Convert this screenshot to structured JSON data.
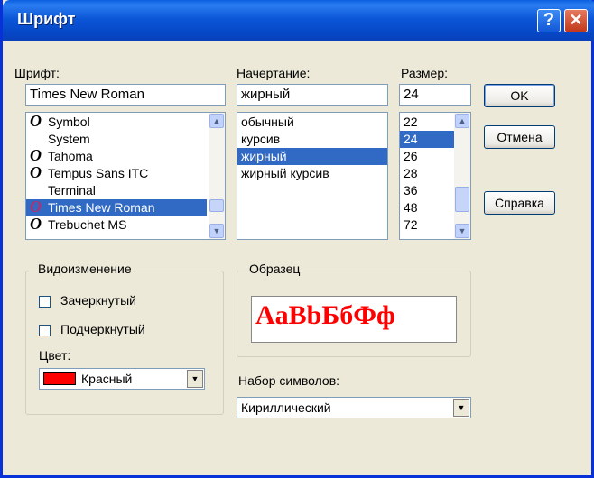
{
  "window": {
    "title": "Шрифт",
    "help_icon": "help-icon",
    "close_icon": "close-icon"
  },
  "font": {
    "label": "Шрифт:",
    "value": "Times New Roman",
    "items": [
      {
        "name": "Symbol",
        "icon": "opentype-font-icon",
        "selected": false
      },
      {
        "name": "System",
        "icon": "",
        "selected": false
      },
      {
        "name": "Tahoma",
        "icon": "opentype-font-icon",
        "selected": false
      },
      {
        "name": "Tempus Sans ITC",
        "icon": "opentype-font-icon",
        "selected": false
      },
      {
        "name": "Terminal",
        "icon": "",
        "selected": false
      },
      {
        "name": "Times New Roman",
        "icon": "opentype-font-icon",
        "selected": true
      },
      {
        "name": "Trebuchet MS",
        "icon": "opentype-font-icon",
        "selected": false
      }
    ]
  },
  "style": {
    "label": "Начертание:",
    "value": "жирный",
    "items": [
      {
        "name": "обычный",
        "selected": false
      },
      {
        "name": "курсив",
        "selected": false
      },
      {
        "name": "жирный",
        "selected": true
      },
      {
        "name": "жирный курсив",
        "selected": false
      }
    ]
  },
  "size": {
    "label": "Размер:",
    "value": "24",
    "items": [
      {
        "name": "22",
        "selected": false
      },
      {
        "name": "24",
        "selected": true
      },
      {
        "name": "26",
        "selected": false
      },
      {
        "name": "28",
        "selected": false
      },
      {
        "name": "36",
        "selected": false
      },
      {
        "name": "48",
        "selected": false
      },
      {
        "name": "72",
        "selected": false
      }
    ]
  },
  "buttons": {
    "ok": "OK",
    "cancel": "Отмена",
    "help": "Справка"
  },
  "effects": {
    "label": "Видоизменение",
    "strikeout": {
      "label": "Зачеркнутый",
      "checked": false
    },
    "underline": {
      "label": "Подчеркнутый",
      "checked": false
    },
    "color_label": "Цвет:",
    "color_value": "Красный",
    "color_hex": "#ff0000"
  },
  "sample": {
    "label": "Образец",
    "text": "AaBbБбФф",
    "color": "#ff0000"
  },
  "charset": {
    "label": "Набор символов:",
    "value": "Кириллический"
  }
}
